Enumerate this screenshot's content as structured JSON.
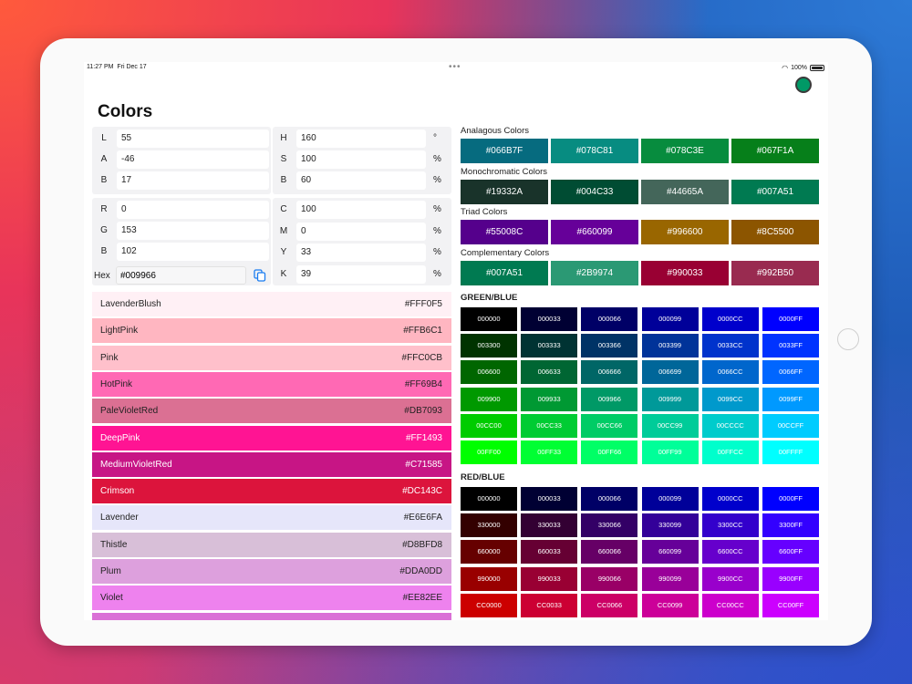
{
  "status": {
    "time": "11:27 PM",
    "date": "Fri Dec 17",
    "battery": "100%"
  },
  "title": "Colors",
  "current_color": "#009966",
  "lab": [
    {
      "label": "L",
      "value": "55"
    },
    {
      "label": "A",
      "value": "-46"
    },
    {
      "label": "B",
      "value": "17"
    }
  ],
  "hsb": [
    {
      "label": "H",
      "value": "160",
      "unit": "°"
    },
    {
      "label": "S",
      "value": "100",
      "unit": "%"
    },
    {
      "label": "B",
      "value": "60",
      "unit": "%"
    }
  ],
  "rgb": [
    {
      "label": "R",
      "value": "0"
    },
    {
      "label": "G",
      "value": "153"
    },
    {
      "label": "B",
      "value": "102"
    }
  ],
  "cmyk": [
    {
      "label": "C",
      "value": "100",
      "unit": "%"
    },
    {
      "label": "M",
      "value": "0",
      "unit": "%"
    },
    {
      "label": "Y",
      "value": "33",
      "unit": "%"
    },
    {
      "label": "K",
      "value": "39",
      "unit": "%"
    }
  ],
  "hex": {
    "label": "Hex",
    "value": "#009966"
  },
  "named_colors": [
    {
      "name": "LavenderBlush",
      "hex": "#FFF0F5",
      "bg": "#FFF0F5",
      "fg": "#222222"
    },
    {
      "name": "LightPink",
      "hex": "#FFB6C1",
      "bg": "#FFB6C1",
      "fg": "#222222"
    },
    {
      "name": "Pink",
      "hex": "#FFC0CB",
      "bg": "#FFC0CB",
      "fg": "#222222"
    },
    {
      "name": "HotPink",
      "hex": "#FF69B4",
      "bg": "#FF69B4",
      "fg": "#222222"
    },
    {
      "name": "PaleVioletRed",
      "hex": "#DB7093",
      "bg": "#DB7093",
      "fg": "#222222"
    },
    {
      "name": "DeepPink",
      "hex": "#FF1493",
      "bg": "#FF1493",
      "fg": "#ffffff"
    },
    {
      "name": "MediumVioletRed",
      "hex": "#C71585",
      "bg": "#C71585",
      "fg": "#ffffff"
    },
    {
      "name": "Crimson",
      "hex": "#DC143C",
      "bg": "#DC143C",
      "fg": "#ffffff"
    },
    {
      "name": "Lavender",
      "hex": "#E6E6FA",
      "bg": "#E6E6FA",
      "fg": "#222222"
    },
    {
      "name": "Thistle",
      "hex": "#D8BFD8",
      "bg": "#D8BFD8",
      "fg": "#222222"
    },
    {
      "name": "Plum",
      "hex": "#DDA0DD",
      "bg": "#DDA0DD",
      "fg": "#222222"
    },
    {
      "name": "Violet",
      "hex": "#EE82EE",
      "bg": "#EE82EE",
      "fg": "#222222"
    }
  ],
  "schemes": [
    {
      "title": "Analagous Colors",
      "colors": [
        "#066B7F",
        "#078C81",
        "#078C3E",
        "#067F1A"
      ]
    },
    {
      "title": "Monochromatic Colors",
      "colors": [
        "#19332A",
        "#004C33",
        "#44665A",
        "#007A51"
      ]
    },
    {
      "title": "Triad Colors",
      "colors": [
        "#55008C",
        "#660099",
        "#996600",
        "#8C5500"
      ]
    },
    {
      "title": "Complementary Colors",
      "colors": [
        "#007A51",
        "#2B9974",
        "#990033",
        "#992B50"
      ]
    }
  ],
  "green_blue": {
    "title": "GREEN/BLUE",
    "rows": [
      [
        "000000",
        "000033",
        "000066",
        "000099",
        "0000CC",
        "0000FF"
      ],
      [
        "003300",
        "003333",
        "003366",
        "003399",
        "0033CC",
        "0033FF"
      ],
      [
        "006600",
        "006633",
        "006666",
        "006699",
        "0066CC",
        "0066FF"
      ],
      [
        "009900",
        "009933",
        "009966",
        "009999",
        "0099CC",
        "0099FF"
      ],
      [
        "00CC00",
        "00CC33",
        "00CC66",
        "00CC99",
        "00CCCC",
        "00CCFF"
      ],
      [
        "00FF00",
        "00FF33",
        "00FF66",
        "00FF99",
        "00FFCC",
        "00FFFF"
      ]
    ]
  },
  "red_blue": {
    "title": "RED/BLUE",
    "rows": [
      [
        "000000",
        "000033",
        "000066",
        "000099",
        "0000CC",
        "0000FF"
      ],
      [
        "330000",
        "330033",
        "330066",
        "330099",
        "3300CC",
        "3300FF"
      ],
      [
        "660000",
        "660033",
        "660066",
        "660099",
        "6600CC",
        "6600FF"
      ],
      [
        "990000",
        "990033",
        "990066",
        "990099",
        "9900CC",
        "9900FF"
      ],
      [
        "CC0000",
        "CC0033",
        "CC0066",
        "CC0099",
        "CC00CC",
        "CC00FF"
      ]
    ]
  }
}
